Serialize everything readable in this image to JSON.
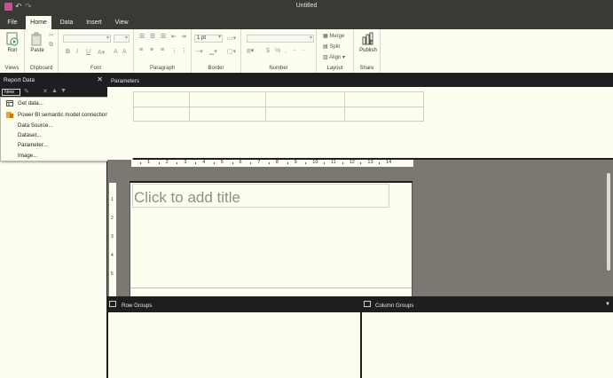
{
  "app": {
    "title": "Untitled",
    "accent": "#d04b97"
  },
  "tabs": [
    {
      "label": "File"
    },
    {
      "label": "Home",
      "active": true
    },
    {
      "label": "Data"
    },
    {
      "label": "Insert"
    },
    {
      "label": "View"
    }
  ],
  "ribbon": {
    "run_label": "Run",
    "paste_label": "Paste",
    "font_size": "1 pt",
    "merge_label": "Merge",
    "split_label": "Split",
    "align_label": "Align",
    "publish_label": "Publish",
    "groups": {
      "views": "Views",
      "clipboard": "Clipboard",
      "font": "Font",
      "paragraph": "Paragraph",
      "border": "Border",
      "number": "Number",
      "layout": "Layout",
      "share": "Share"
    },
    "bold_glyph": "B",
    "italic_glyph": "I",
    "underline_glyph": "U",
    "currency_glyph": "$",
    "percent_glyph": "%"
  },
  "report_data": {
    "title": "Report Data",
    "close_glyph": "✕",
    "new_label": "New"
  },
  "menu": {
    "items": [
      {
        "label": "Get data...",
        "icon": "get-data-icon"
      },
      {
        "label": "Power BI semantic model connection...",
        "icon": "semantic-model-icon"
      },
      {
        "label": "Data Source..."
      },
      {
        "label": "Dataset..."
      },
      {
        "label": "Parameter..."
      },
      {
        "label": "Image..."
      }
    ]
  },
  "parameters": {
    "label": "Parameters"
  },
  "ruler": {
    "h": [
      "1",
      "2",
      "3",
      "4",
      "5",
      "6",
      "7",
      "8",
      "9",
      "10",
      "11",
      "12",
      "13",
      "14"
    ],
    "v": [
      "1",
      "2",
      "3",
      "4",
      "5"
    ]
  },
  "report": {
    "title_placeholder": "Click to add title"
  },
  "groups": {
    "row_label": "Row Groups",
    "col_label": "Column Groups"
  }
}
